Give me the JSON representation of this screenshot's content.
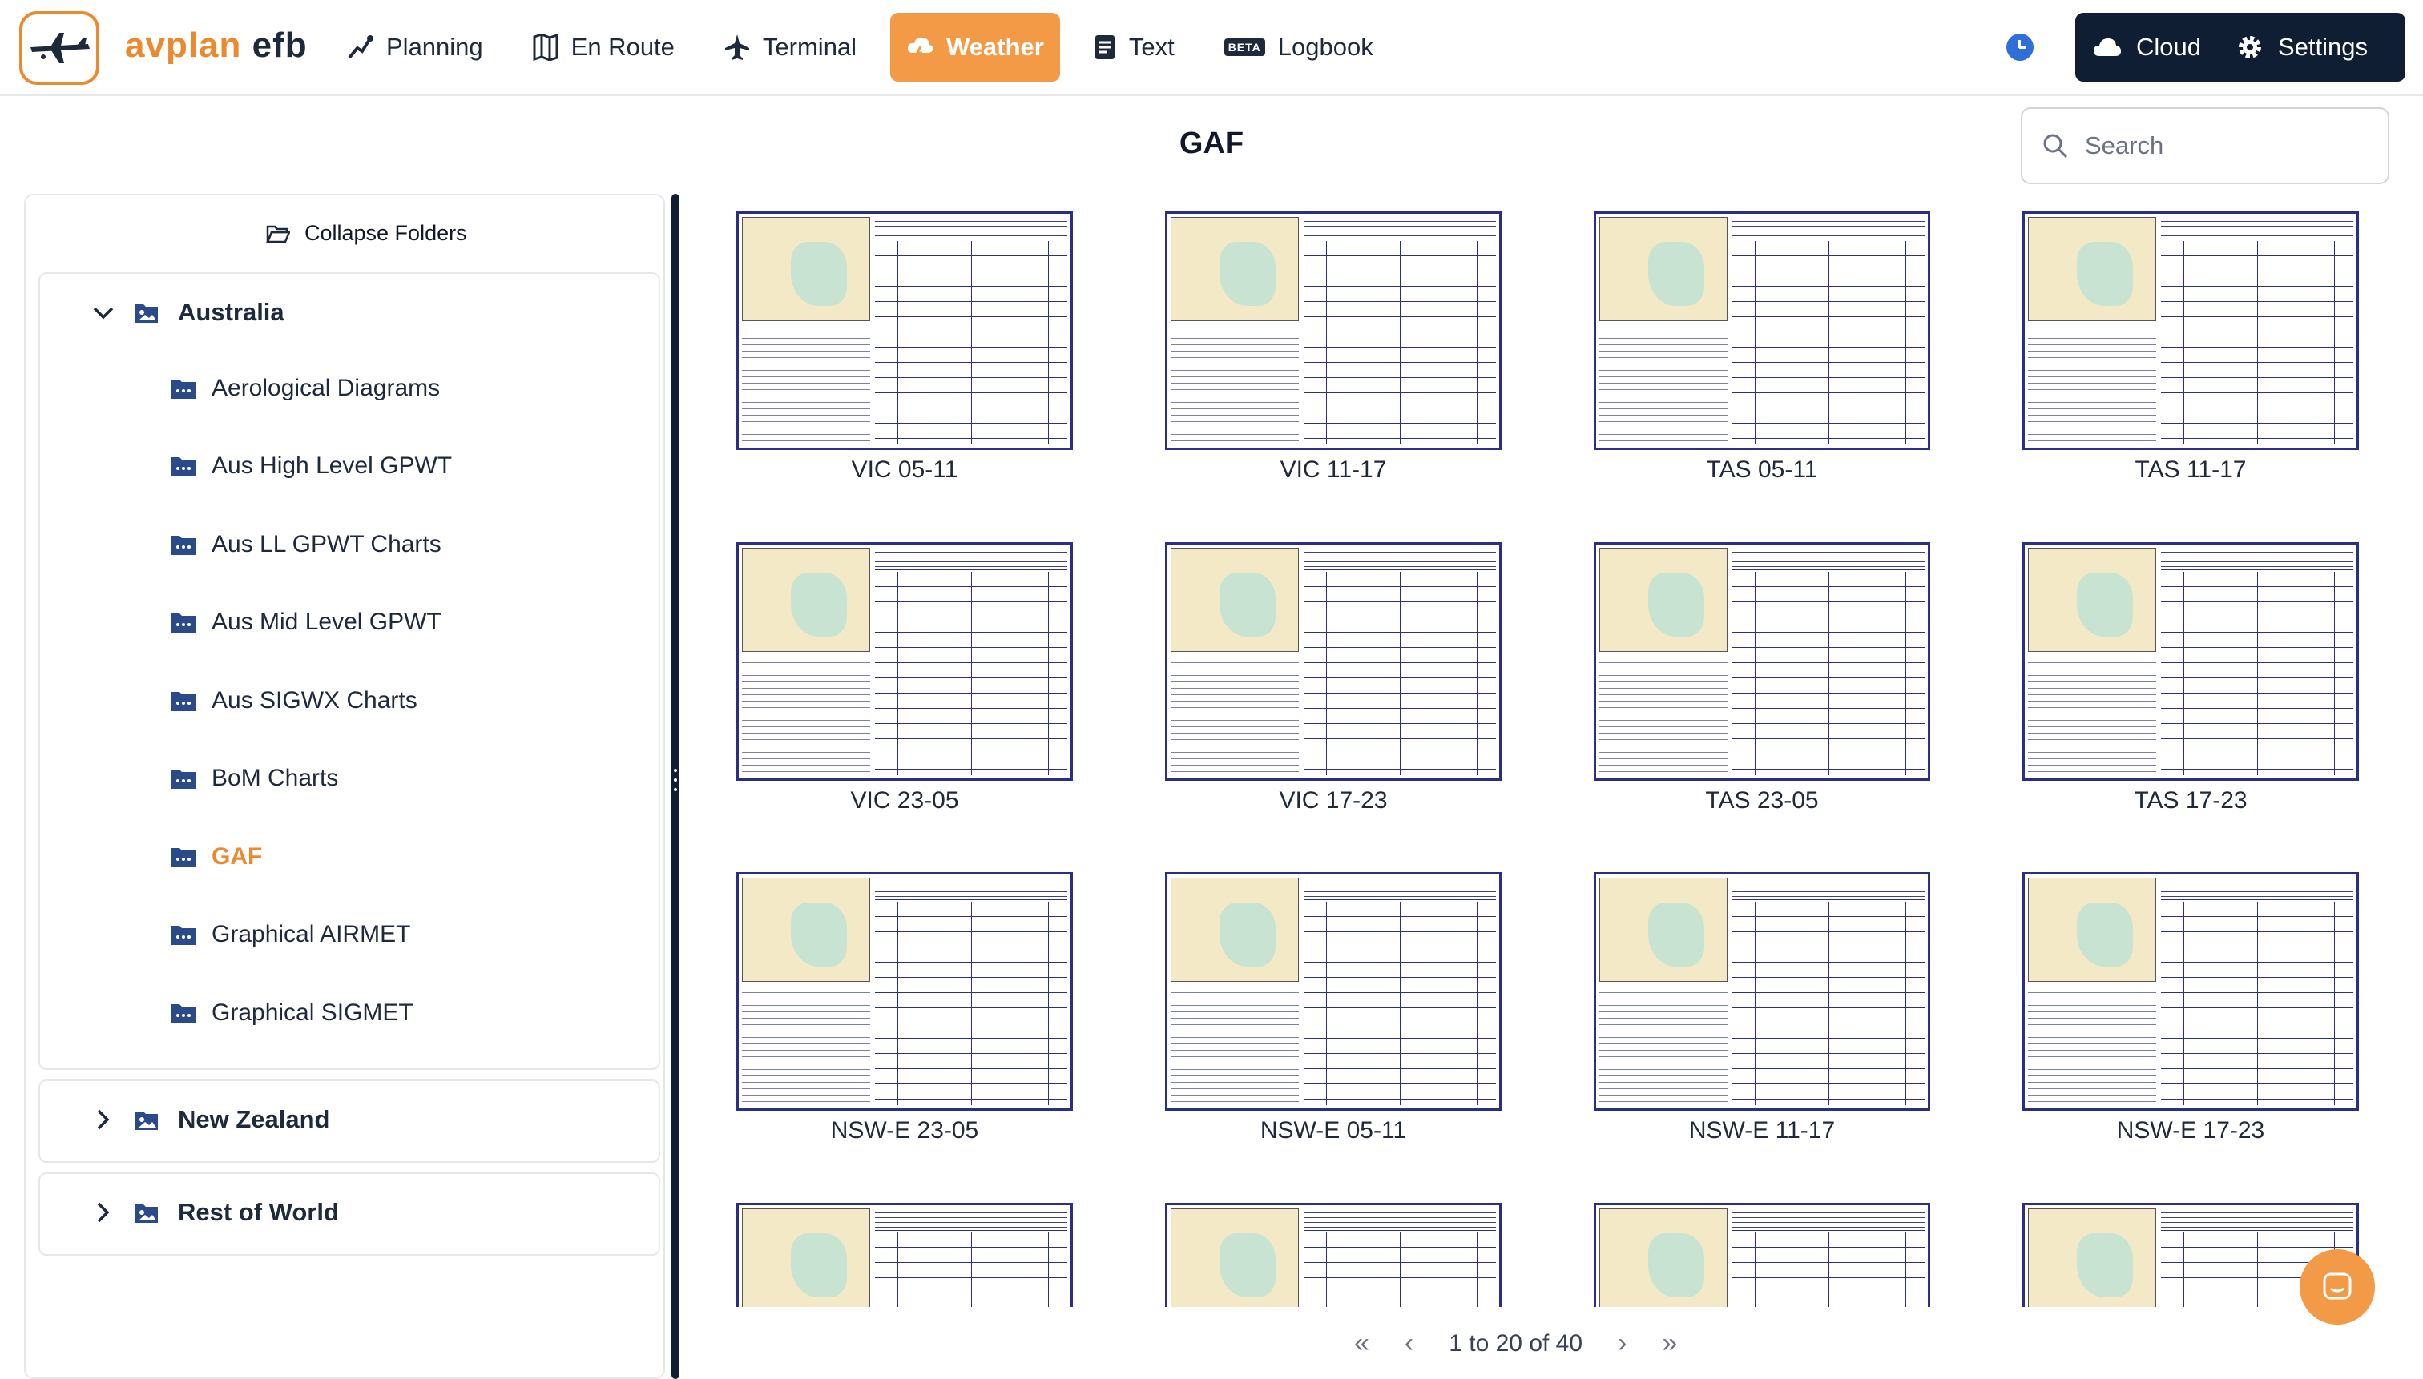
{
  "app": {
    "brand_prefix": "avplan",
    "brand_suffix": "efb"
  },
  "nav": {
    "items": [
      {
        "label": "Planning",
        "icon": "planning-icon",
        "active": false
      },
      {
        "label": "En Route",
        "icon": "map-icon",
        "active": false
      },
      {
        "label": "Terminal",
        "icon": "plane-icon",
        "active": false
      },
      {
        "label": "Weather",
        "icon": "weather-icon",
        "active": true
      },
      {
        "label": "Text",
        "icon": "document-icon",
        "active": false
      },
      {
        "label": "Logbook",
        "icon": "book-icon",
        "active": false,
        "badge": "BETA"
      }
    ],
    "cloud_label": "Cloud",
    "settings_label": "Settings"
  },
  "page": {
    "title": "GAF"
  },
  "search": {
    "placeholder": "Search",
    "value": ""
  },
  "sidebar": {
    "collapse_label": "Collapse Folders",
    "groups": [
      {
        "label": "Australia",
        "expanded": true,
        "items": [
          "Aerological Diagrams",
          "Aus High Level GPWT",
          "Aus LL GPWT Charts",
          "Aus Mid Level GPWT",
          "Aus SIGWX Charts",
          "BoM Charts",
          "GAF",
          "Graphical AIRMET",
          "Graphical SIGMET"
        ],
        "active_item": "GAF"
      },
      {
        "label": "New Zealand",
        "expanded": false
      },
      {
        "label": "Rest of World",
        "expanded": false
      }
    ]
  },
  "charts": [
    {
      "label": "VIC 05-11"
    },
    {
      "label": "VIC 11-17"
    },
    {
      "label": "TAS 05-11"
    },
    {
      "label": "TAS 11-17"
    },
    {
      "label": "VIC 23-05"
    },
    {
      "label": "VIC 17-23"
    },
    {
      "label": "TAS 23-05"
    },
    {
      "label": "TAS 17-23"
    },
    {
      "label": "NSW-E 23-05"
    },
    {
      "label": "NSW-E 05-11"
    },
    {
      "label": "NSW-E 11-17"
    },
    {
      "label": "NSW-E 17-23"
    },
    {
      "label": ""
    },
    {
      "label": ""
    },
    {
      "label": ""
    },
    {
      "label": ""
    }
  ],
  "pagination": {
    "summary": "1 to 20 of 40"
  },
  "colors": {
    "accent": "#f29a45",
    "navy": "#0f1e33",
    "brand_orange": "#ea8a2e"
  }
}
